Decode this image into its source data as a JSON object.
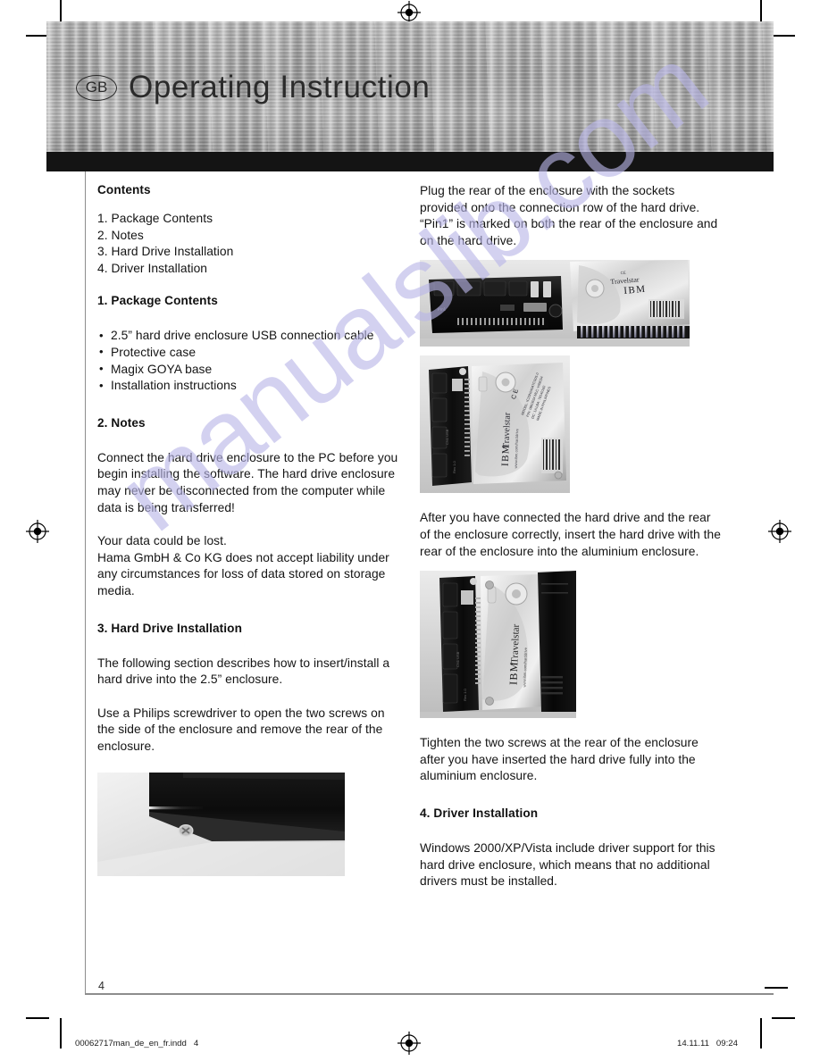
{
  "document": {
    "language_badge": "GB",
    "header_title": "Operating Instruction",
    "page_number": "4",
    "watermark": "manualslib.com",
    "footer": {
      "file_name": "00062717man_de_en_fr.indd   4",
      "timestamp": "14.11.11   09:24"
    }
  },
  "left_column": {
    "contents_heading": "Contents",
    "contents_items": [
      "1. Package Contents",
      "2. Notes",
      "3. Hard Drive Installation",
      "4. Driver Installation"
    ],
    "section1_heading": "1. Package Contents",
    "section1_bullets": [
      "2.5” hard drive enclosure USB connection cable",
      "Protective case",
      "Magix  GOYA base",
      "Installation instructions"
    ],
    "section2_heading": "2. Notes",
    "section2_para1": "Connect the hard drive enclosure to the PC before you begin installing the software. The hard drive enclosure may never be disconnected from the computer while data is being transferred!",
    "section2_para2": "Your data could be lost.\nHama GmbH & Co KG does not accept liability under any circumstances for loss of data stored on storage media.",
    "section3_heading": "3. Hard Drive Installation",
    "section3_para1": "The following section describes how to insert/install a hard drive into the 2.5” enclosure.",
    "section3_para2": "Use a Philips screwdriver to open the two screws on the side of the enclosure and remove the rear of the enclosure.",
    "photo_screw_caption": "enclosure-side-screw-photo"
  },
  "right_column": {
    "para_pin1": "Plug the rear of the enclosure with the sockets provided onto the connection row of the hard drive. “Pin1” is marked on both the rear of the enclosure and on the hard drive.",
    "photo_pin1_caption": "enclosure-rear-and-hard-drive-photo",
    "photo_connected_caption": "hard-drive-connected-to-rear-photo",
    "para_insert": "After you have connected the hard drive and the rear of the enclosure correctly, insert the hard drive with the rear of the enclosure into the aluminium enclosure.",
    "photo_inserted_caption": "hard-drive-inserted-into-aluminium-enclosure-photo",
    "para_tighten": "Tighten the two screws at the rear of the enclosure after you have inserted the hard drive fully into the aluminium enclosure.",
    "section4_heading": "4. Driver Installation",
    "section4_para": "Windows 2000/XP/Vista  include driver support for this hard drive enclosure, which means that no additional drivers must be installed."
  },
  "colors": {
    "banner_metal": "#a8a8a8",
    "black_bar": "#141414",
    "text": "#141414",
    "rule": "#8d8d8d",
    "watermark": "#b9b6e8"
  }
}
